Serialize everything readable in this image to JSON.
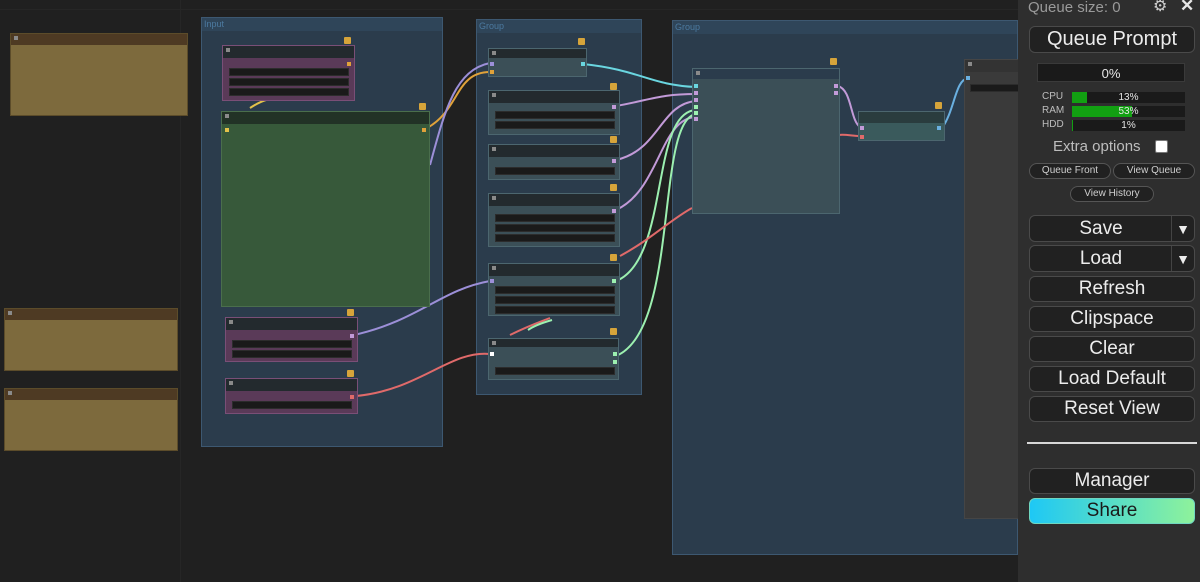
{
  "groups": {
    "input": "Input",
    "group_a": "Group",
    "group_b": "Group"
  },
  "panel": {
    "queue_size": "Queue size: 0",
    "queue_prompt": "Queue Prompt",
    "progress": "0%",
    "progress_value": 0,
    "resources": [
      {
        "label": "CPU",
        "value": "13%",
        "fraction": 0.13
      },
      {
        "label": "RAM",
        "value": "53%",
        "fraction": 0.53
      },
      {
        "label": "HDD",
        "value": "1%",
        "fraction": 0.01
      }
    ],
    "extra_options": "Extra options",
    "queue_front": "Queue Front",
    "view_queue": "View Queue",
    "view_history": "View History",
    "save": "Save",
    "load": "Load",
    "dropdown_arrow": "▼",
    "refresh": "Refresh",
    "clipspace": "Clipspace",
    "clear": "Clear",
    "load_default": "Load Default",
    "reset_view": "Reset View",
    "manager": "Manager",
    "share": "Share",
    "gear_icon": "gear-icon",
    "close_icon": "close-icon",
    "close_glyph": "✕",
    "gear_glyph": "⚙"
  },
  "colors": {
    "accent_green": "#12a012",
    "share_gradient_start": "#1ec8f5",
    "share_gradient_end": "#8ef29b",
    "group_fill": "#2b3c4c",
    "note_fill": "#7d6a3d",
    "node_purple": "#5a3a58",
    "node_green": "#37593a"
  }
}
